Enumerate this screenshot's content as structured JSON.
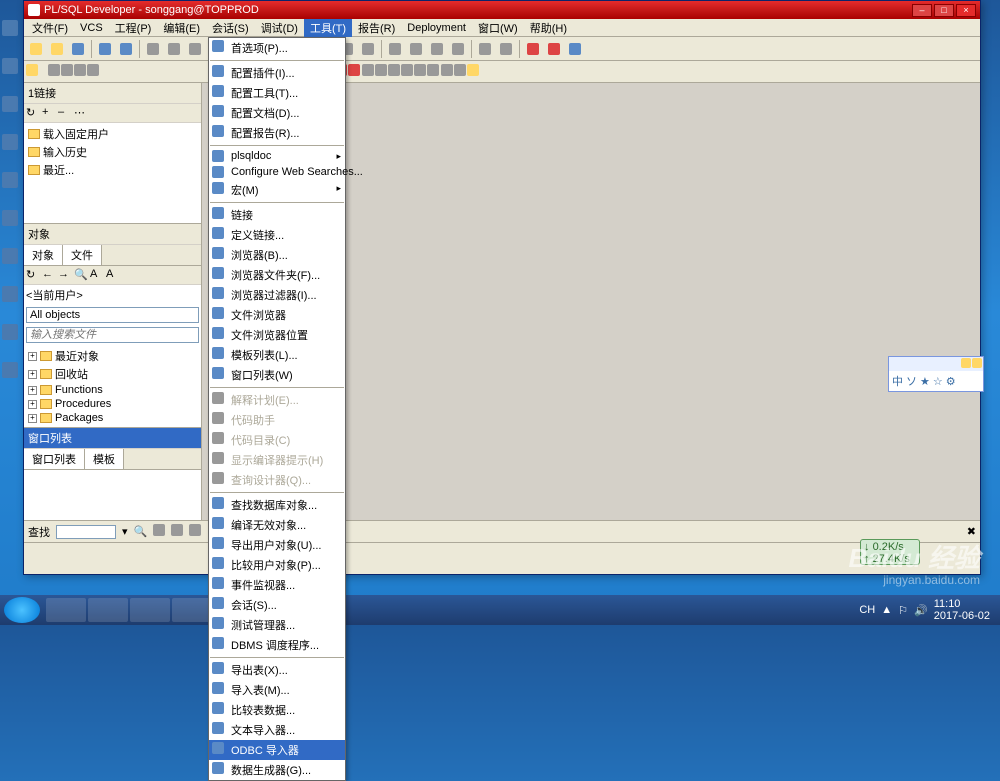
{
  "titlebar": {
    "title": "PL/SQL Developer - songgang@TOPPROD"
  },
  "menubar": {
    "items": [
      "文件(F)",
      "VCS",
      "工程(P)",
      "编辑(E)",
      "会话(S)",
      "调试(D)",
      "工具(T)",
      "报告(R)",
      "Deployment",
      "窗口(W)",
      "帮助(H)"
    ],
    "activeIndex": 6
  },
  "leftPanel": {
    "connHeader": "1链接",
    "connTree": [
      "载入固定用户",
      "输入历史",
      "最近..."
    ],
    "objHeader": "对象",
    "objTabs": [
      "对象",
      "文件"
    ],
    "currentUser": "<当前用户>",
    "allObjects": "All objects",
    "searchPlaceholder": "输入搜索文件",
    "objTree": [
      "最近对象",
      "回收站",
      "Functions",
      "Procedures",
      "Packages"
    ],
    "winHeader": "窗口列表",
    "winTabs": [
      "窗口列表",
      "模板"
    ]
  },
  "toolsMenu": {
    "groups": [
      [
        {
          "t": "首选项(P)...",
          "icon": "wrench"
        }
      ],
      [
        {
          "t": "配置插件(I)...",
          "icon": "plug"
        },
        {
          "t": "配置工具(T)...",
          "icon": "tool"
        },
        {
          "t": "配置文档(D)...",
          "icon": "doc"
        },
        {
          "t": "配置报告(R)...",
          "icon": "report"
        }
      ],
      [
        {
          "t": "plsqldoc",
          "sub": true
        },
        {
          "t": "Configure Web Searches...",
          "icon": "globe"
        },
        {
          "t": "宏(M)",
          "sub": true,
          "icon": "macro"
        }
      ],
      [
        {
          "t": "链接",
          "icon": "link"
        },
        {
          "t": "定义链接...",
          "icon": "deflink"
        },
        {
          "t": "浏览器(B)...",
          "icon": "browser"
        },
        {
          "t": "浏览器文件夹(F)...",
          "icon": "folder"
        },
        {
          "t": "浏览器过滤器(I)...",
          "icon": "filter"
        },
        {
          "t": "文件浏览器",
          "icon": "fbrowser"
        },
        {
          "t": "文件浏览器位置",
          "icon": "floc"
        },
        {
          "t": "模板列表(L)...",
          "icon": "template"
        },
        {
          "t": "窗口列表(W)",
          "icon": "winlist"
        }
      ],
      [
        {
          "t": "解释计划(E)...",
          "icon": "plan",
          "dis": true
        },
        {
          "t": "代码助手",
          "icon": "assist",
          "dis": true
        },
        {
          "t": "代码目录(C)",
          "icon": "toc",
          "dis": true
        },
        {
          "t": "显示编译器提示(H)",
          "icon": "hint",
          "dis": true
        },
        {
          "t": "查询设计器(Q)...",
          "icon": "qd",
          "dis": true
        }
      ],
      [
        {
          "t": "查找数据库对象...",
          "icon": "find"
        },
        {
          "t": "编译无效对象...",
          "icon": "compile"
        },
        {
          "t": "导出用户对象(U)...",
          "icon": "export"
        },
        {
          "t": "比较用户对象(P)...",
          "icon": "compare"
        },
        {
          "t": "事件监视器...",
          "icon": "monitor"
        },
        {
          "t": "会话(S)...",
          "icon": "session"
        },
        {
          "t": "测试管理器...",
          "icon": "test"
        },
        {
          "t": "DBMS 调度程序...",
          "icon": "sched"
        }
      ],
      [
        {
          "t": "导出表(X)...",
          "icon": "exptbl"
        },
        {
          "t": "导入表(M)...",
          "icon": "imptbl"
        },
        {
          "t": "比较表数据...",
          "icon": "cmptbl"
        },
        {
          "t": "文本导入器...",
          "icon": "textimp"
        },
        {
          "t": "ODBC 导入器",
          "icon": "odbc",
          "hover": true
        },
        {
          "t": "数据生成器(G)...",
          "icon": "gen"
        }
      ]
    ]
  },
  "findbar": {
    "label": "查找"
  },
  "netWidget": {
    "down": "0.2K/s",
    "up": "27.4K/s"
  },
  "ime": {
    "chars": [
      "中",
      "ソ",
      "★",
      "☆",
      "⚙"
    ]
  },
  "tray": {
    "lang": "CH",
    "net": "🔊",
    "time": "11:10",
    "date": "2017-06-02"
  },
  "watermark": {
    "main": "Baidu 经验",
    "sub": "jingyan.baidu.com"
  }
}
